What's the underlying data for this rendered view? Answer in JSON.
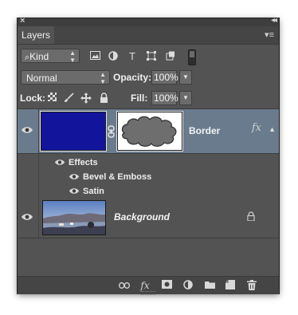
{
  "panel": {
    "close_glyph": "×",
    "collapse_glyph": "◂◂",
    "tab_label": "Layers",
    "menu_glyph": "▾≡"
  },
  "filter": {
    "kind_label": "Kind",
    "icons": [
      "image-filter-icon",
      "adjustment-filter-icon",
      "type-filter-icon",
      "shape-filter-icon",
      "smart-object-filter-icon"
    ]
  },
  "blend": {
    "mode": "Normal",
    "opacity_label": "Opacity:",
    "opacity_value": "100%",
    "fill_label": "Fill:",
    "fill_value": "100%"
  },
  "lock": {
    "label": "Lock:"
  },
  "layers": {
    "border": {
      "name": "Border",
      "fx": "fx",
      "color": "#13149c"
    },
    "effects": {
      "header": "Effects",
      "items": [
        "Bevel & Emboss",
        "Satin"
      ]
    },
    "background": {
      "name": "Background"
    }
  },
  "colors": {
    "panel_bg": "#535353",
    "selected_row": "#6a7b8d"
  }
}
